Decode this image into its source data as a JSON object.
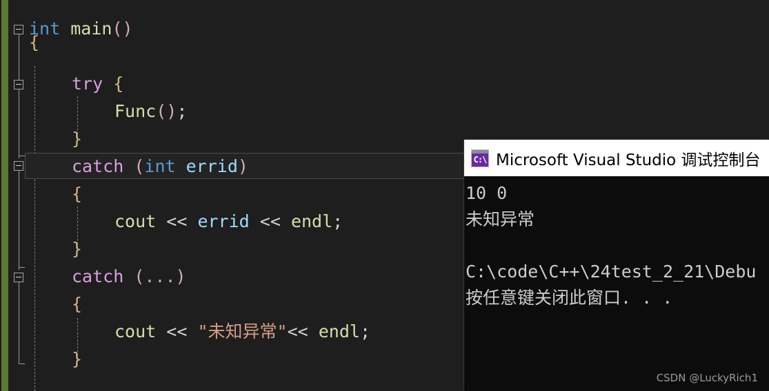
{
  "editor": {
    "background_color": "#1e1e1e",
    "change_bar_color": "#5d7a32",
    "current_line_border_color": "#4e4e4e",
    "lines": [
      {
        "indent": 0,
        "text": "int main()"
      },
      {
        "indent": 1,
        "text": "{"
      },
      {
        "indent": 2,
        "text": "try {"
      },
      {
        "indent": 3,
        "text": "Func();"
      },
      {
        "indent": 2,
        "text": "}"
      },
      {
        "indent": 2,
        "text": "catch (int errid)"
      },
      {
        "indent": 2,
        "text": "{"
      },
      {
        "indent": 3,
        "text": "cout << errid << endl;"
      },
      {
        "indent": 2,
        "text": "}"
      },
      {
        "indent": 2,
        "text": "catch (...)"
      },
      {
        "indent": 2,
        "text": "{"
      },
      {
        "indent": 3,
        "text": "cout << \"未知异常\"<< endl;"
      },
      {
        "indent": 2,
        "text": "}"
      }
    ],
    "tokens": {
      "l0_int": "int",
      "l0_sp": " ",
      "l0_main": "main",
      "l0_paren": "()",
      "l1_brace": "{",
      "l2_try": "try",
      "l2_brace": "{",
      "l3_func": "Func",
      "l3_paren": "()",
      "l3_semi": ";",
      "l4_brace": "}",
      "l5_catch": "catch",
      "l5_open": "(",
      "l5_int": "int",
      "l5_errid": "errid",
      "l5_close": ")",
      "l6_brace": "{",
      "l7_cout": "cout",
      "l7_op1": "<<",
      "l7_errid": "errid",
      "l7_op2": "<<",
      "l7_endl": "endl",
      "l7_semi": ";",
      "l8_brace": "}",
      "l9_catch": "catch",
      "l9_args": "(...)",
      "l10_brace": "{",
      "l11_cout": "cout",
      "l11_op1": "<<",
      "l11_str": "\"未知异常\"",
      "l11_op2": "<<",
      "l11_endl": "endl",
      "l11_semi": ";",
      "l12_brace": "}"
    },
    "collapse_icon": "minus-box"
  },
  "console": {
    "title": "Microsoft Visual Studio 调试控制台",
    "icon": "console-app-icon",
    "icon_glyph": "C:\\",
    "titlebar_color": "#ffffff",
    "body_color": "#0c0c0c",
    "text_color": "#cccccc",
    "output": [
      "10 0",
      "未知异常",
      "",
      "C:\\code\\C++\\24test_2_21\\Debu",
      "按任意键关闭此窗口. . ."
    ]
  },
  "watermark": {
    "text": "CSDN @LuckyRich1"
  }
}
